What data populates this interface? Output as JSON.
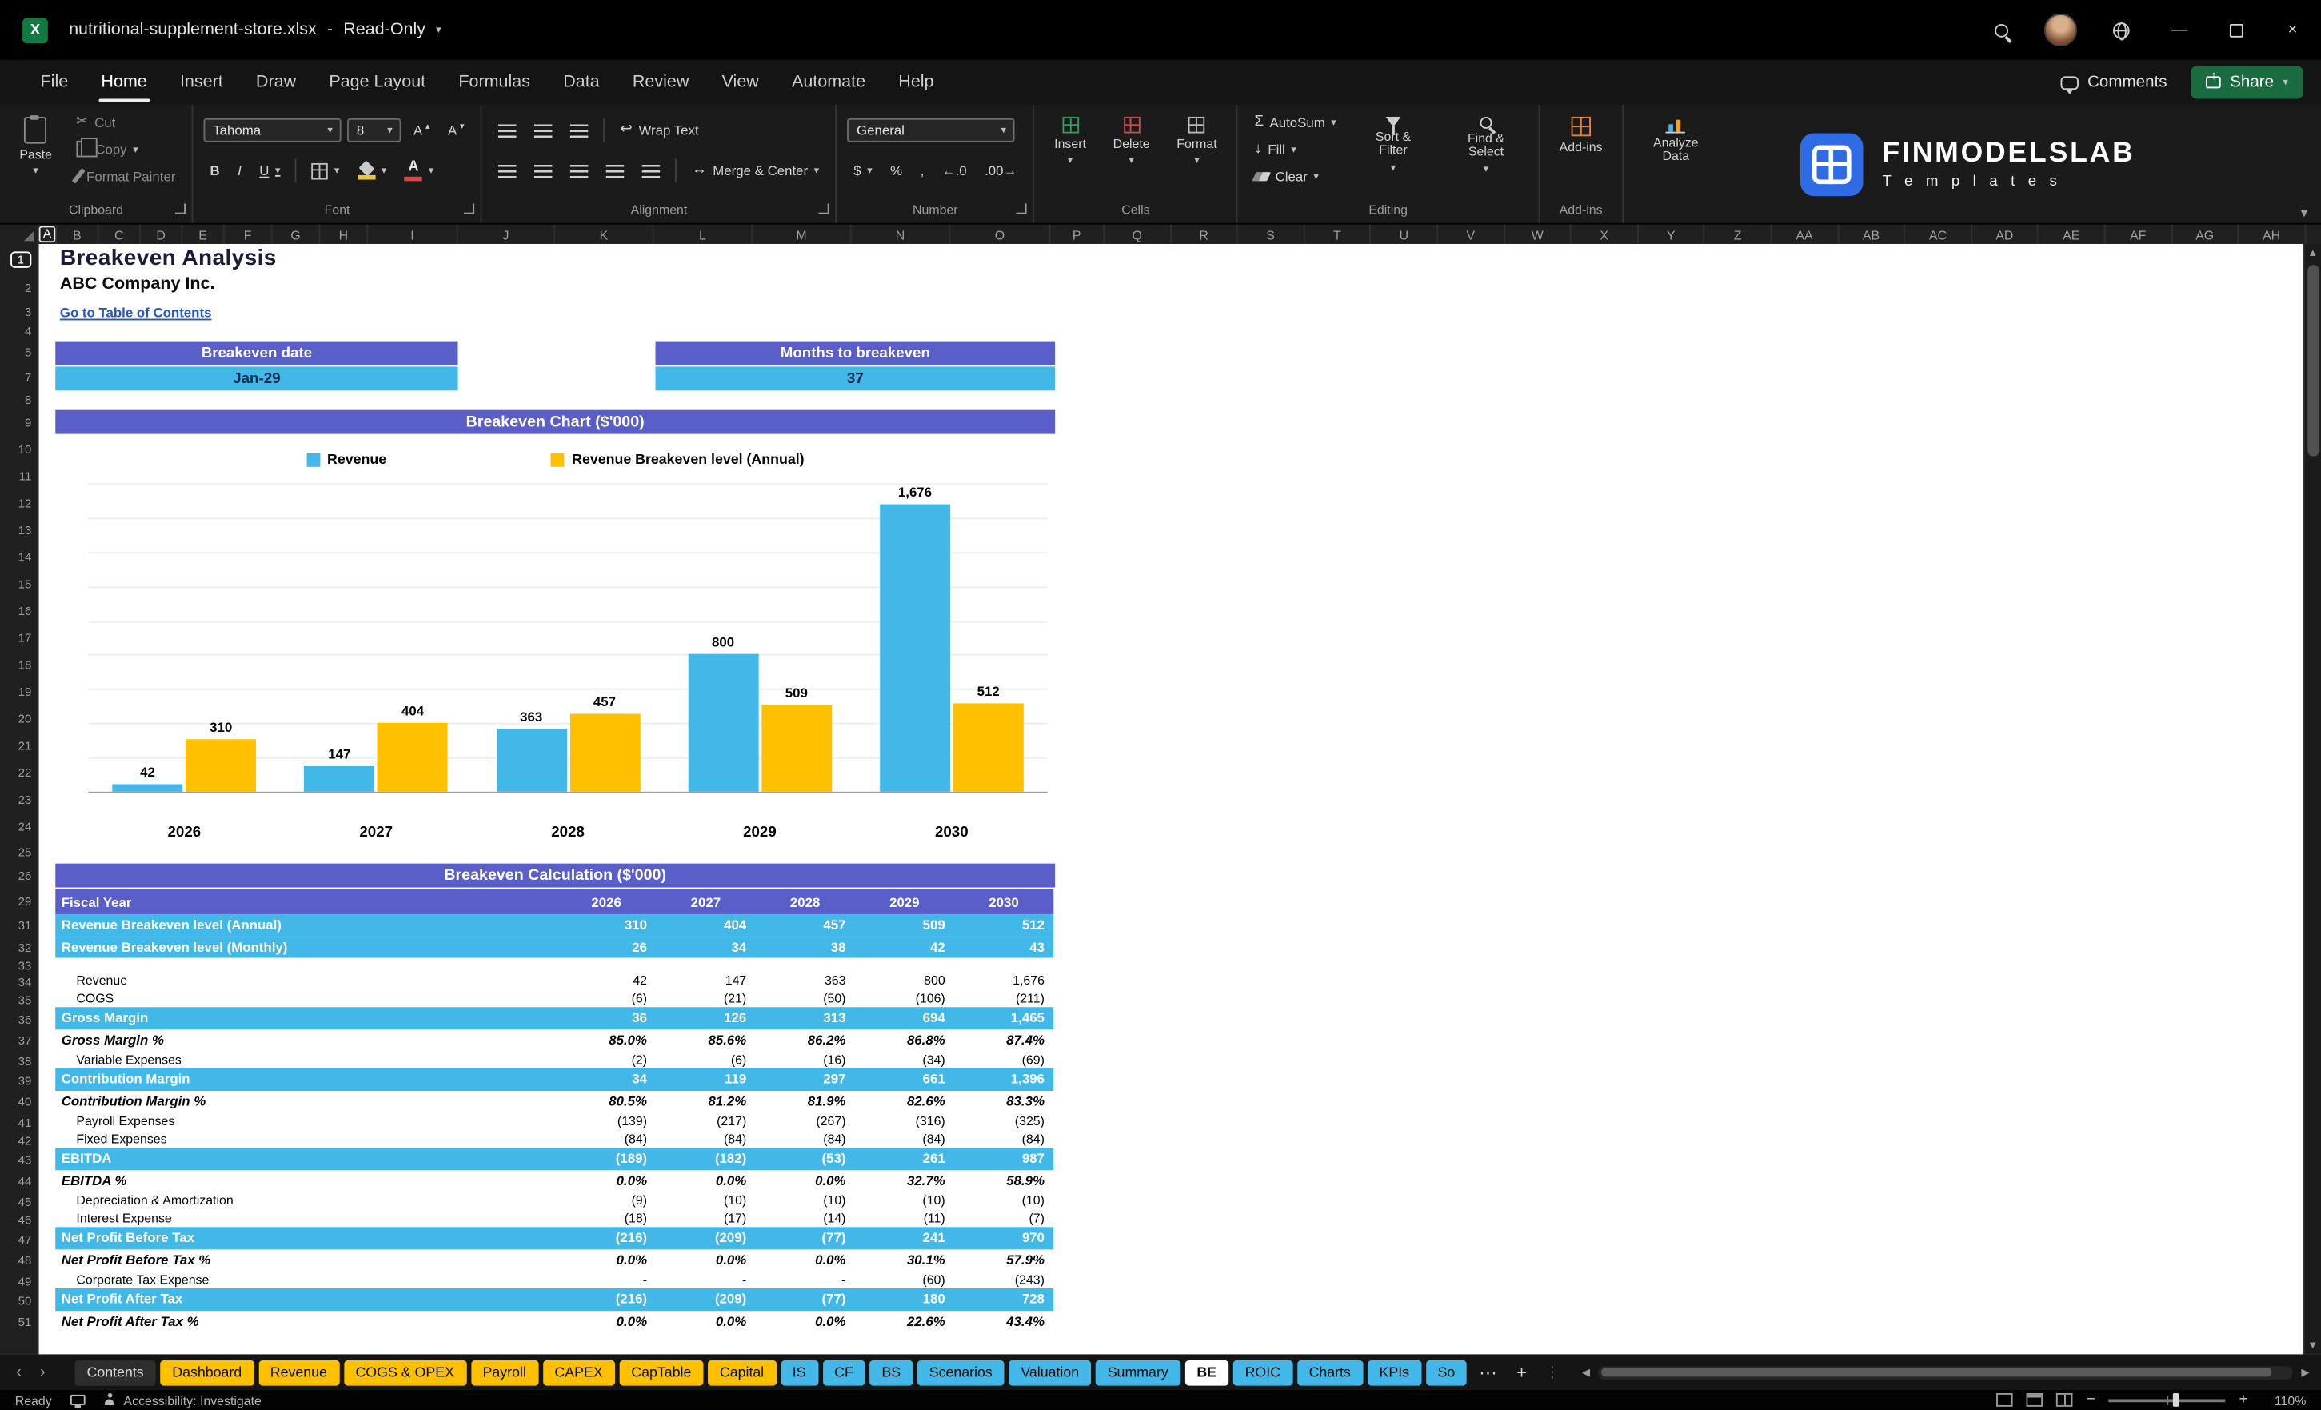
{
  "titlebar": {
    "filename": "nutritional-supplement-store.xlsx",
    "separator": "-",
    "mode": "Read-Only"
  },
  "menubar": {
    "tabs": [
      "File",
      "Home",
      "Insert",
      "Draw",
      "Page Layout",
      "Formulas",
      "Data",
      "Review",
      "View",
      "Automate",
      "Help"
    ],
    "active_tab": "Home",
    "comments_label": "Comments",
    "share_label": "Share"
  },
  "ribbon": {
    "groups": {
      "clipboard": {
        "label": "Clipboard",
        "paste": "Paste",
        "cut": "Cut",
        "copy": "Copy",
        "format_painter": "Format Painter"
      },
      "font": {
        "label": "Font",
        "family": "Tahoma",
        "size": "8",
        "bold": "B",
        "italic": "I",
        "underline": "U"
      },
      "alignment": {
        "label": "Alignment",
        "wrap": "Wrap Text",
        "merge": "Merge & Center"
      },
      "number": {
        "label": "Number",
        "format": "General",
        "currency": "$",
        "percent": "%",
        "comma": ",",
        "inc_decimal": "←.0",
        "dec_decimal": ".00→"
      },
      "cells": {
        "label": "Cells",
        "insert": "Insert",
        "delete": "Delete",
        "format": "Format"
      },
      "editing": {
        "label": "Editing",
        "autosum": "AutoSum",
        "fill": "Fill",
        "clear": "Clear",
        "sort_filter": "Sort & Filter",
        "find_select": "Find & Select"
      },
      "addins": {
        "label": "Add-ins",
        "addins_btn": "Add-ins",
        "analyze": "Analyze Data"
      }
    },
    "brand": {
      "title": "FINMODELSLAB",
      "subtitle": "T e m p l a t e s"
    }
  },
  "grid": {
    "columns": [
      "A",
      "B",
      "C",
      "D",
      "E",
      "F",
      "G",
      "H",
      "I",
      "J",
      "K",
      "L",
      "M",
      "N",
      "O",
      "P",
      "Q",
      "R",
      "S",
      "T",
      "U",
      "V",
      "W",
      "X",
      "Y",
      "Z",
      "AA",
      "AB",
      "AC",
      "AD",
      "AE",
      "AF",
      "AG",
      "AH"
    ],
    "rows": [
      1,
      2,
      3,
      4,
      5,
      7,
      8,
      9,
      10,
      11,
      12,
      13,
      14,
      15,
      16,
      17,
      18,
      19,
      20,
      21,
      22,
      23,
      24,
      25,
      26,
      29,
      31,
      32,
      33,
      34,
      35,
      36,
      37,
      38,
      39,
      40,
      41,
      42,
      43,
      44,
      45,
      46,
      47,
      48,
      49,
      50,
      51
    ]
  },
  "sheet": {
    "title": "Breakeven Analysis",
    "company": "ABC Company Inc.",
    "toc_link": "Go to Table of Contents",
    "breakeven_date_label": "Breakeven date",
    "breakeven_date_value": "Jan-29",
    "months_label": "Months to breakeven",
    "months_value": "37",
    "chart_title": "Breakeven Chart ($'000)",
    "calc_title": "Breakeven Calculation ($'000)"
  },
  "chart_data": {
    "type": "bar",
    "title": "Breakeven Chart ($'000)",
    "categories": [
      "2026",
      "2027",
      "2028",
      "2029",
      "2030"
    ],
    "series": [
      {
        "name": "Revenue",
        "color": "#41b8e8",
        "values": [
          42,
          147,
          363,
          800,
          1676
        ],
        "labels": [
          "42",
          "147",
          "363",
          "800",
          "1,676"
        ]
      },
      {
        "name": "Revenue Breakeven level (Annual)",
        "color": "#ffc000",
        "values": [
          310,
          404,
          457,
          509,
          512
        ],
        "labels": [
          "310",
          "404",
          "457",
          "509",
          "512"
        ]
      }
    ],
    "ylim": [
      0,
      1800
    ],
    "gridline_step": 200,
    "legend_position": "top",
    "data_labels": true,
    "grid": true
  },
  "table": {
    "header_label": "Fiscal Year",
    "years": [
      "2026",
      "2027",
      "2028",
      "2029",
      "2030"
    ],
    "rows": [
      {
        "label": "Revenue Breakeven level (Annual)",
        "style": "band",
        "values": [
          "310",
          "404",
          "457",
          "509",
          "512"
        ]
      },
      {
        "label": "Revenue Breakeven level (Monthly)",
        "style": "band",
        "values": [
          "26",
          "34",
          "38",
          "42",
          "43"
        ]
      },
      {
        "label": "",
        "style": "spacer",
        "values": [
          "",
          "",
          "",
          "",
          ""
        ]
      },
      {
        "label": "Revenue",
        "style": "detail",
        "values": [
          "42",
          "147",
          "363",
          "800",
          "1,676"
        ]
      },
      {
        "label": "COGS",
        "style": "detail",
        "values": [
          "(6)",
          "(21)",
          "(50)",
          "(106)",
          "(211)"
        ]
      },
      {
        "label": "Gross Margin",
        "style": "band",
        "values": [
          "36",
          "126",
          "313",
          "694",
          "1,465"
        ]
      },
      {
        "label": "Gross Margin %",
        "style": "pct",
        "values": [
          "85.0%",
          "85.6%",
          "86.2%",
          "86.8%",
          "87.4%"
        ]
      },
      {
        "label": "Variable Expenses",
        "style": "detail",
        "values": [
          "(2)",
          "(6)",
          "(16)",
          "(34)",
          "(69)"
        ]
      },
      {
        "label": "Contribution Margin",
        "style": "band",
        "values": [
          "34",
          "119",
          "297",
          "661",
          "1,396"
        ]
      },
      {
        "label": "Contribution Margin %",
        "style": "pct",
        "values": [
          "80.5%",
          "81.2%",
          "81.9%",
          "82.6%",
          "83.3%"
        ]
      },
      {
        "label": "Payroll Expenses",
        "style": "detail",
        "values": [
          "(139)",
          "(217)",
          "(267)",
          "(316)",
          "(325)"
        ]
      },
      {
        "label": "Fixed Expenses",
        "style": "detail",
        "values": [
          "(84)",
          "(84)",
          "(84)",
          "(84)",
          "(84)"
        ]
      },
      {
        "label": "EBITDA",
        "style": "band",
        "values": [
          "(189)",
          "(182)",
          "(53)",
          "261",
          "987"
        ]
      },
      {
        "label": "EBITDA %",
        "style": "pct",
        "values": [
          "0.0%",
          "0.0%",
          "0.0%",
          "32.7%",
          "58.9%"
        ]
      },
      {
        "label": "Depreciation & Amortization",
        "style": "detail",
        "values": [
          "(9)",
          "(10)",
          "(10)",
          "(10)",
          "(10)"
        ]
      },
      {
        "label": "Interest Expense",
        "style": "detail",
        "values": [
          "(18)",
          "(17)",
          "(14)",
          "(11)",
          "(7)"
        ]
      },
      {
        "label": "Net Profit Before Tax",
        "style": "band",
        "values": [
          "(216)",
          "(209)",
          "(77)",
          "241",
          "970"
        ]
      },
      {
        "label": "Net Profit Before Tax %",
        "style": "pct",
        "values": [
          "0.0%",
          "0.0%",
          "0.0%",
          "30.1%",
          "57.9%"
        ]
      },
      {
        "label": "Corporate Tax Expense",
        "style": "detail",
        "values": [
          "-",
          "-",
          "-",
          "(60)",
          "(243)"
        ]
      },
      {
        "label": "Net Profit After Tax",
        "style": "band",
        "values": [
          "(216)",
          "(209)",
          "(77)",
          "180",
          "728"
        ]
      },
      {
        "label": "Net Profit After Tax %",
        "style": "pct",
        "values": [
          "0.0%",
          "0.0%",
          "0.0%",
          "22.6%",
          "43.4%"
        ]
      }
    ]
  },
  "sheet_tabs": {
    "items": [
      {
        "label": "Contents",
        "color": "plain"
      },
      {
        "label": "Dashboard",
        "color": "yellow"
      },
      {
        "label": "Revenue",
        "color": "yellow"
      },
      {
        "label": "COGS & OPEX",
        "color": "yellow"
      },
      {
        "label": "Payroll",
        "color": "yellow"
      },
      {
        "label": "CAPEX",
        "color": "yellow"
      },
      {
        "label": "CapTable",
        "color": "yellow"
      },
      {
        "label": "Capital",
        "color": "yellow"
      },
      {
        "label": "IS",
        "color": "blue"
      },
      {
        "label": "CF",
        "color": "blue"
      },
      {
        "label": "BS",
        "color": "blue"
      },
      {
        "label": "Scenarios",
        "color": "blue"
      },
      {
        "label": "Valuation",
        "color": "blue"
      },
      {
        "label": "Summary",
        "color": "blue"
      },
      {
        "label": "BE",
        "color": "active"
      },
      {
        "label": "ROIC",
        "color": "blue"
      },
      {
        "label": "Charts",
        "color": "blue"
      },
      {
        "label": "KPIs",
        "color": "blue"
      },
      {
        "label": "So",
        "color": "blue"
      }
    ],
    "active": "BE"
  },
  "statusbar": {
    "ready": "Ready",
    "accessibility": "Accessibility: Investigate",
    "zoom": "110%"
  },
  "colors": {
    "banner_purple": "#5a5ec9",
    "sky_blue": "#41b8e8",
    "gold": "#ffc000",
    "link_blue": "#2456c5",
    "brand_blue": "#2e6be4",
    "share_green": "#1b6b40",
    "excel_green": "#0f7b41"
  }
}
